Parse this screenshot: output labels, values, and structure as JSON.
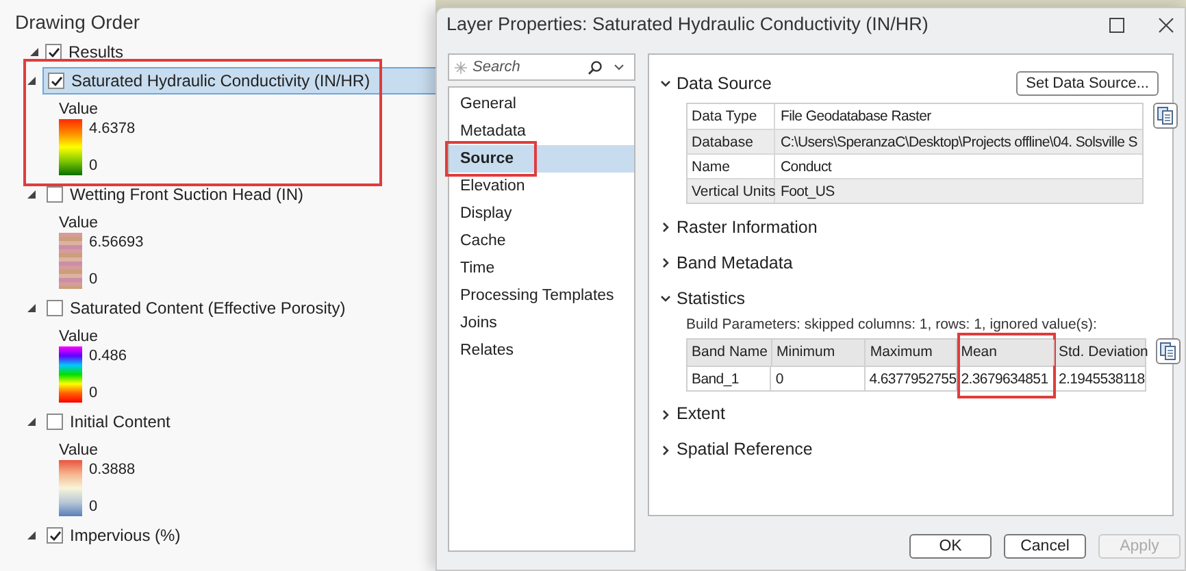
{
  "drawing_order": {
    "title": "Drawing Order",
    "group": {
      "label": "Results",
      "checked": true,
      "expanded": true
    },
    "layers": [
      {
        "label": "Saturated Hydraulic Conductivity (IN/HR)",
        "checked": true,
        "selected": true,
        "highlighted": true,
        "expanded": true,
        "legend_title": "Value",
        "max": "4.6378",
        "min": "0",
        "kind": "red-yellow-green"
      },
      {
        "label": "Wetting Front Suction Head (IN)",
        "checked": false,
        "selected": false,
        "highlighted": false,
        "expanded": true,
        "legend_title": "Value",
        "max": "6.56693",
        "min": "0",
        "kind": "striped-pastel"
      },
      {
        "label": "Saturated Content (Effective Porosity)",
        "checked": false,
        "selected": false,
        "highlighted": false,
        "expanded": true,
        "legend_title": "Value",
        "max": "0.486",
        "min": "0",
        "kind": "spectrum"
      },
      {
        "label": "Initial Content",
        "checked": false,
        "selected": false,
        "highlighted": false,
        "expanded": true,
        "legend_title": "Value",
        "max": "0.3888",
        "min": "0",
        "kind": "red-white-blue"
      },
      {
        "label": "Impervious (%)",
        "checked": true,
        "selected": false,
        "highlighted": false,
        "expanded": true
      }
    ]
  },
  "dialog": {
    "title": "Layer Properties: Saturated Hydraulic Conductivity (IN/HR)",
    "search": {
      "placeholder": "Search"
    },
    "nav": [
      {
        "label": "General",
        "selected": false,
        "highlighted": false
      },
      {
        "label": "Metadata",
        "selected": false,
        "highlighted": false
      },
      {
        "label": "Source",
        "selected": true,
        "highlighted": true
      },
      {
        "label": "Elevation",
        "selected": false,
        "highlighted": false
      },
      {
        "label": "Display",
        "selected": false,
        "highlighted": false
      },
      {
        "label": "Cache",
        "selected": false,
        "highlighted": false
      },
      {
        "label": "Time",
        "selected": false,
        "highlighted": false
      },
      {
        "label": "Processing Templates",
        "selected": false,
        "highlighted": false
      },
      {
        "label": "Joins",
        "selected": false,
        "highlighted": false
      },
      {
        "label": "Relates",
        "selected": false,
        "highlighted": false
      }
    ],
    "set_source_button": "Set Data Source...",
    "sections": [
      {
        "title": "Data Source",
        "expanded": true,
        "kind": "properties",
        "rows": [
          [
            "Data Type",
            "File Geodatabase Raster"
          ],
          [
            "Database",
            "C:\\Users\\SperanzaC\\Desktop\\Projects offline\\04. Solsville S"
          ],
          [
            "Name",
            "Conduct"
          ],
          [
            "Vertical Units",
            "Foot_US"
          ]
        ]
      },
      {
        "title": "Raster Information",
        "expanded": false
      },
      {
        "title": "Band Metadata",
        "expanded": false
      },
      {
        "title": "Statistics",
        "expanded": true,
        "kind": "statistics",
        "note": "Build Parameters: skipped columns: 1, rows: 1, ignored value(s):",
        "columns": [
          {
            "label": "Band Name",
            "highlighted": false
          },
          {
            "label": "Minimum",
            "highlighted": false
          },
          {
            "label": "Maximum",
            "highlighted": false
          },
          {
            "label": "Mean",
            "highlighted": true
          },
          {
            "label": "Std. Deviation",
            "highlighted": false
          }
        ],
        "rows": [
          [
            "Band_1",
            "0",
            "4.6377952755",
            "2.3679634851",
            "2.1945538118"
          ]
        ]
      },
      {
        "title": "Extent",
        "expanded": false
      },
      {
        "title": "Spatial Reference",
        "expanded": false
      }
    ],
    "buttons": [
      {
        "label": "OK",
        "disabled": false
      },
      {
        "label": "Cancel",
        "disabled": false
      },
      {
        "label": "Apply",
        "disabled": true
      }
    ]
  }
}
